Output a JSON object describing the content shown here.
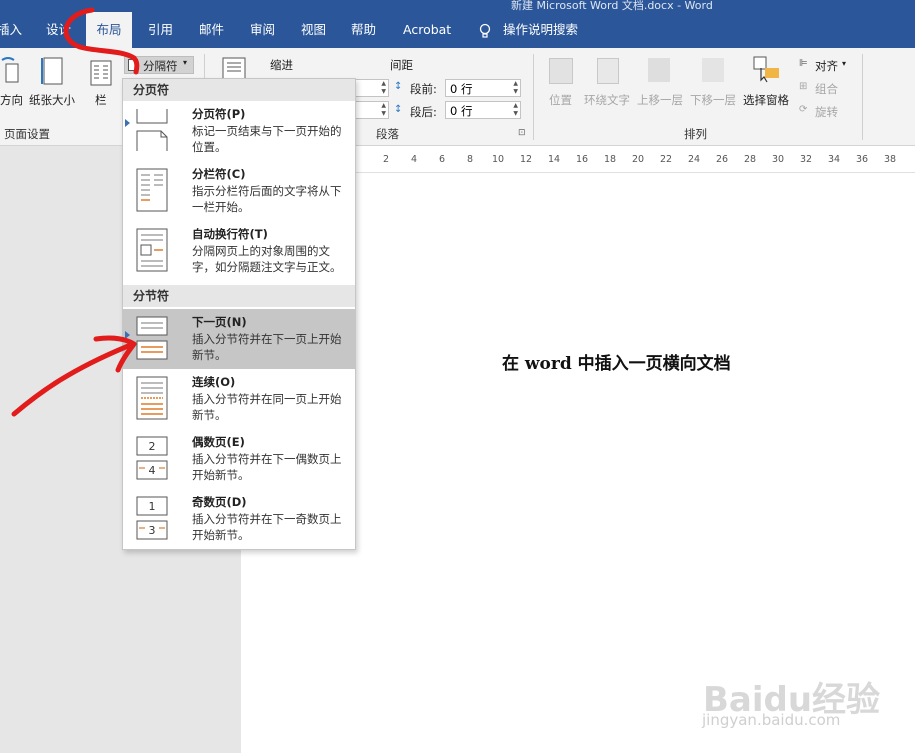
{
  "window": {
    "title": "新建 Microsoft Word 文档.docx  -  Word"
  },
  "tabs": [
    {
      "label": "插入"
    },
    {
      "label": "设计"
    },
    {
      "label": "布局"
    },
    {
      "label": "引用"
    },
    {
      "label": "邮件"
    },
    {
      "label": "审阅"
    },
    {
      "label": "视图"
    },
    {
      "label": "帮助"
    },
    {
      "label": "Acrobat"
    },
    {
      "label": "操作说明搜索"
    }
  ],
  "ribbon": {
    "page_setup": {
      "direction": "方向",
      "paper_size": "纸张大小",
      "columns": "栏",
      "breaks": "分隔符",
      "group_label": "页面设置"
    },
    "paragraph": {
      "indent": "缩进",
      "spacing": "间距",
      "before_label": "段前:",
      "before_value": "0 行",
      "after_label": "段后:",
      "after_value": "0 行",
      "group_label": "段落"
    },
    "arrange": {
      "position": "位置",
      "wrap_text": "环绕文字",
      "bring_forward": "上移一层",
      "send_backward": "下移一层",
      "selection_pane": "选择窗格",
      "align": "对齐",
      "group": "组合",
      "rotate": "旋转",
      "group_label": "排列"
    }
  },
  "ruler": {
    "ticks": [
      "2",
      "4",
      "6",
      "8",
      "10",
      "12",
      "14",
      "16",
      "18",
      "20",
      "22",
      "24",
      "26",
      "28",
      "30",
      "32",
      "34",
      "36",
      "38"
    ]
  },
  "document": {
    "text": "在 word 中插入一页横向文档"
  },
  "menu": {
    "page_breaks_header": "分页符",
    "section_breaks_header": "分节符",
    "items": [
      {
        "title": "分页符(P)",
        "desc": "标记一页结束与下一页开始的位置。"
      },
      {
        "title": "分栏符(C)",
        "desc": "指示分栏符后面的文字将从下一栏开始。"
      },
      {
        "title": "自动换行符(T)",
        "desc": "分隔网页上的对象周围的文字，如分隔题注文字与正文。"
      },
      {
        "title": "下一页(N)",
        "desc": "插入分节符并在下一页上开始新节。"
      },
      {
        "title": "连续(O)",
        "desc": "插入分节符并在同一页上开始新节。"
      },
      {
        "title": "偶数页(E)",
        "desc": "插入分节符并在下一偶数页上开始新节。"
      },
      {
        "title": "奇数页(D)",
        "desc": "插入分节符并在下一奇数页上开始新节。"
      }
    ]
  },
  "watermark": {
    "logo": "Baidu经验",
    "url": "jingyan.baidu.com"
  },
  "colors": {
    "ribbon_blue": "#2b579a",
    "annotation_red": "#e21b1b",
    "highlight": "#c6c6c6"
  }
}
